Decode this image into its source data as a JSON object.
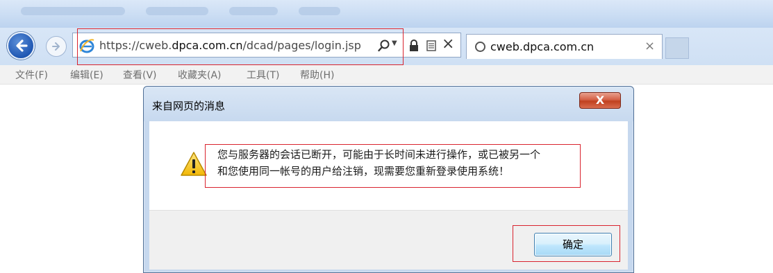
{
  "browser": {
    "address_bar": {
      "url_prefix": "https://cweb.",
      "url_domain": "dpca.com.cn",
      "url_path": "/dcad/pages/login.jsp"
    },
    "tab": {
      "title": "cweb.dpca.com.cn",
      "close_glyph": "×"
    },
    "stop_glyph": "×",
    "menu": [
      {
        "label": "文件(F)"
      },
      {
        "label": "编辑(E)"
      },
      {
        "label": "查看(V)"
      },
      {
        "label": "收藏夹(A)"
      },
      {
        "label": "工具(T)"
      },
      {
        "label": "帮助(H)"
      }
    ],
    "icons": {
      "back": "back-arrow-icon",
      "forward": "forward-arrow-icon",
      "site": "ie-logo-icon",
      "search": "search-icon",
      "lock": "lock-icon",
      "compat": "compatibility-view-icon",
      "loading": "loading-spinner-icon"
    }
  },
  "dialog": {
    "title": "来自网页的消息",
    "close_label": "X",
    "message_line1": "您与服务器的会话已断开，可能由于长时间未进行操作，或已被另一个",
    "message_line2": "和您使用同一帐号的用户给注销，现需要您重新登录使用系统！",
    "ok_label": "确定",
    "icon": "warning-icon"
  },
  "colors": {
    "highlight_box": "#d9232e",
    "chrome_blue": "#cfe0f4",
    "back_button": "#1f57b3",
    "close_button": "#c0401f"
  }
}
